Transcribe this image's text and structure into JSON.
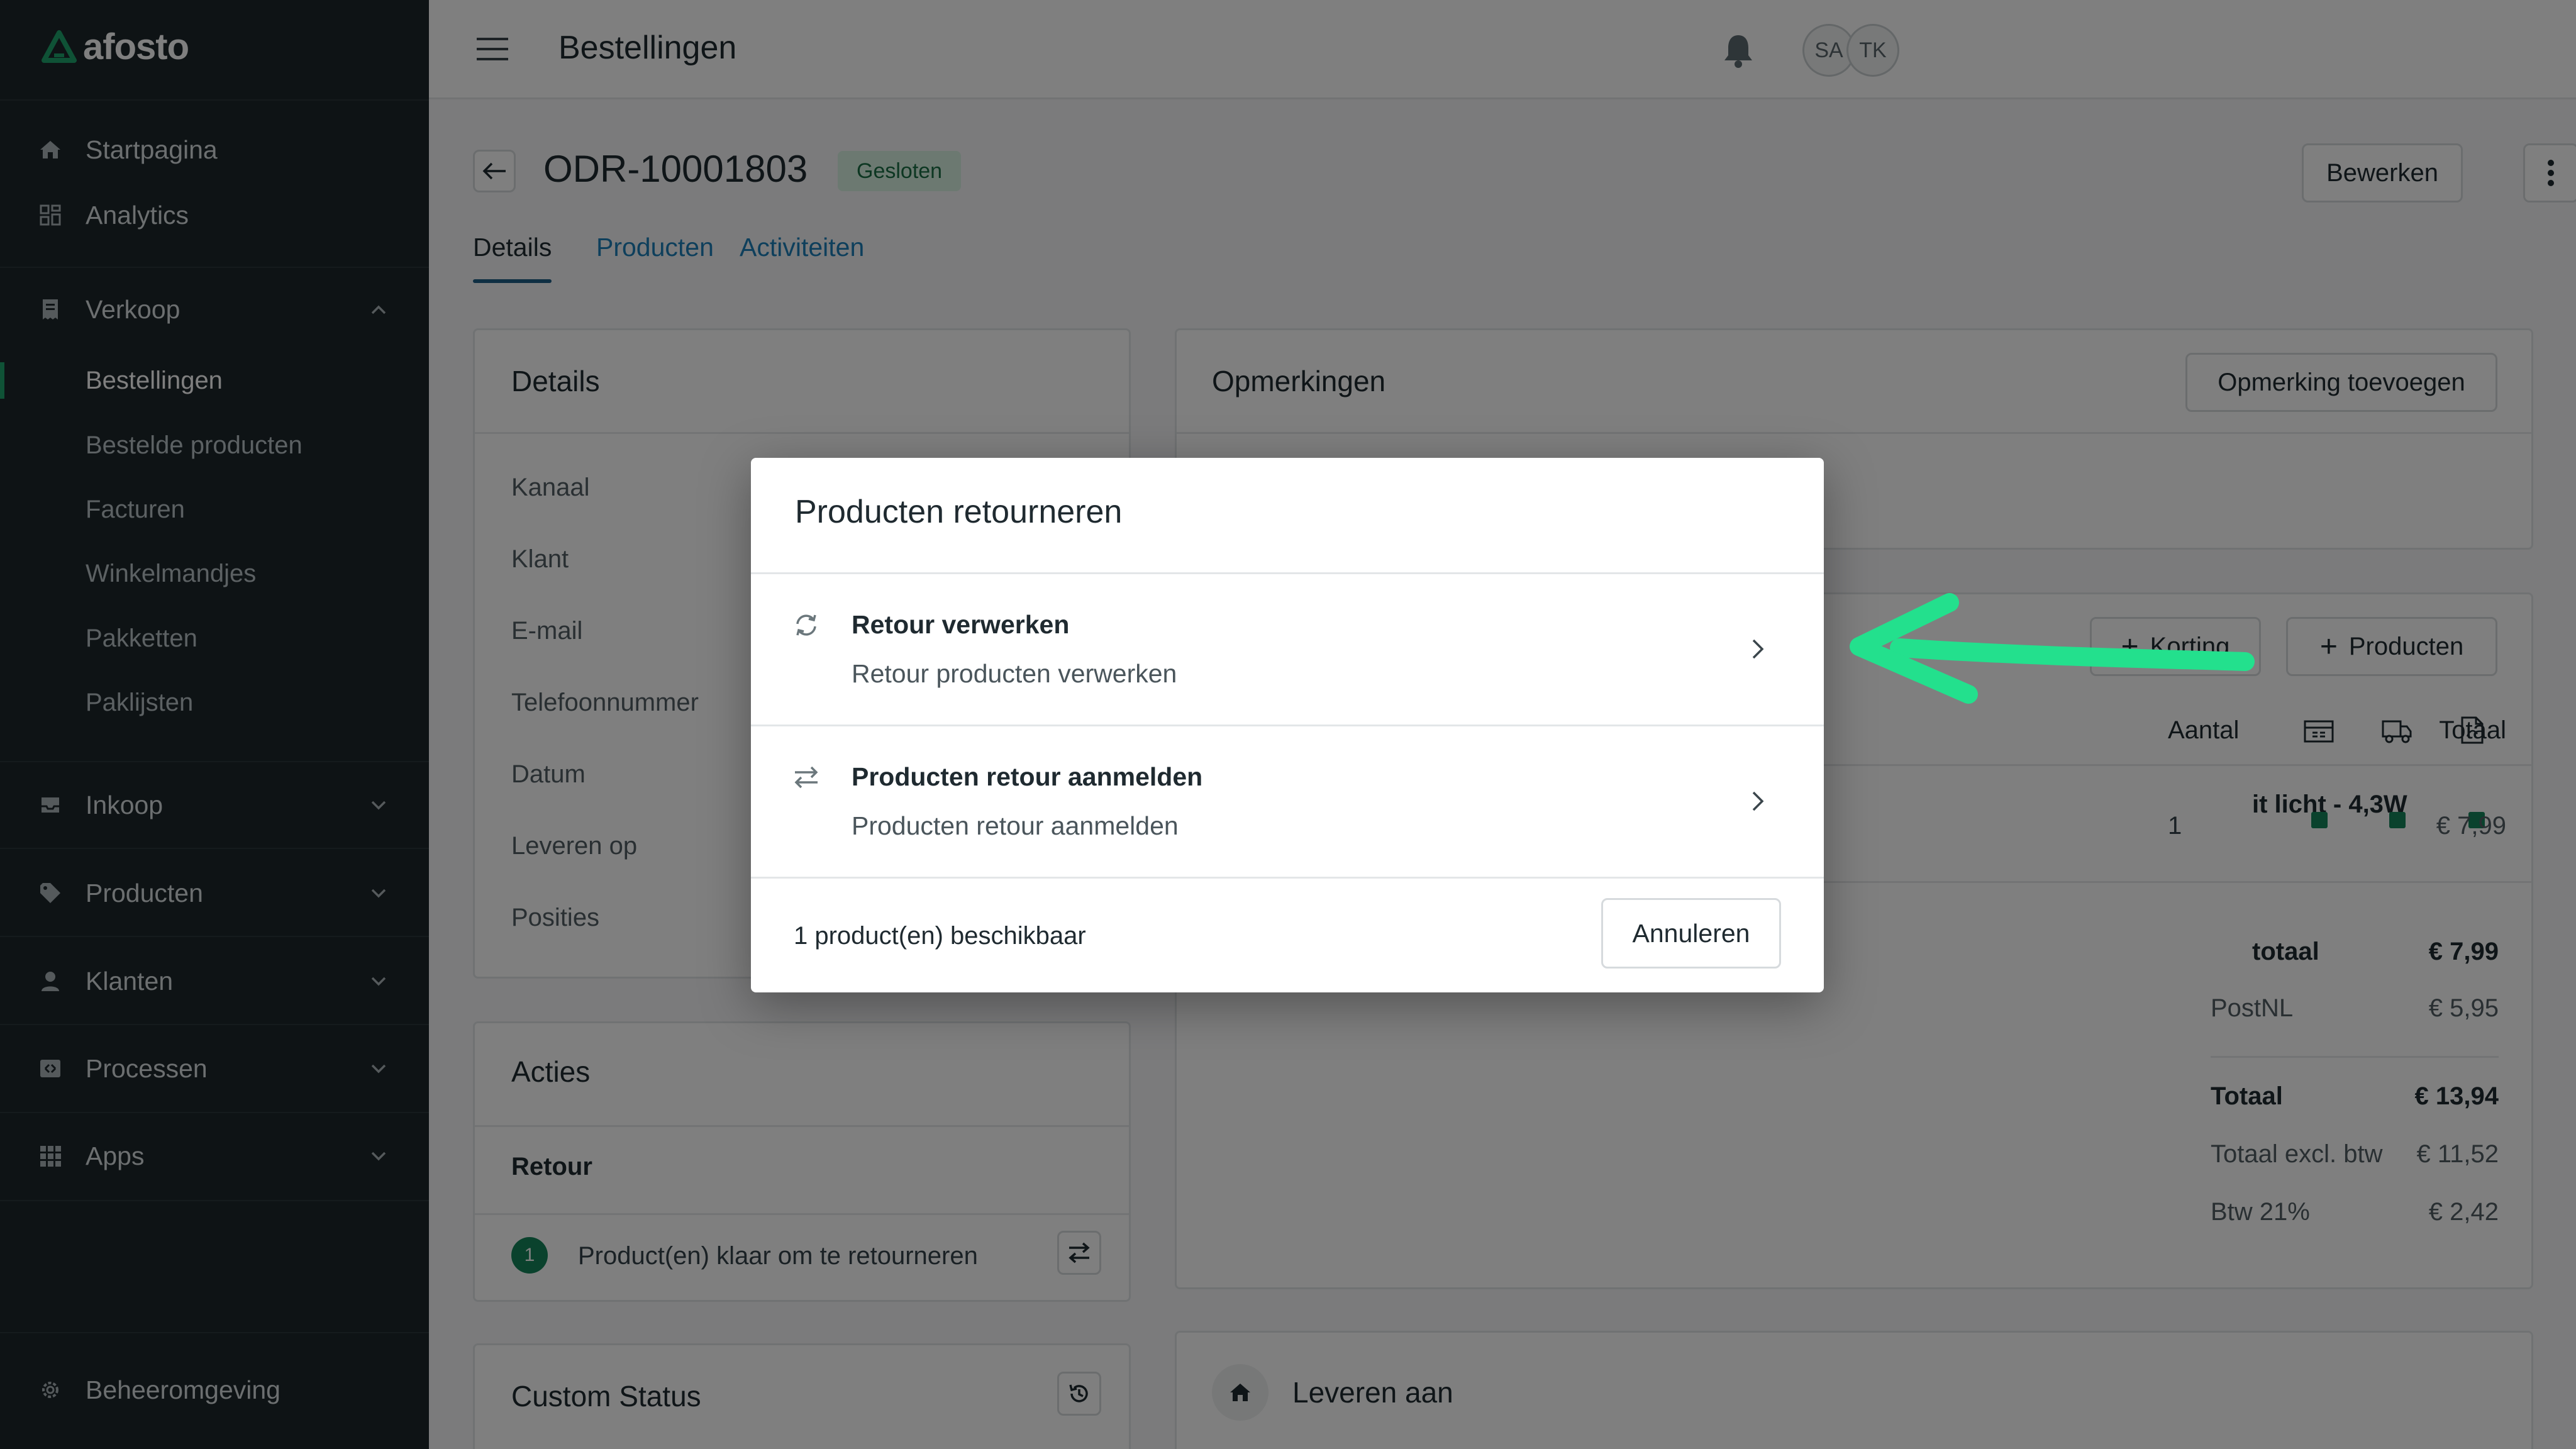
{
  "brand": {
    "name": "afosto",
    "accent": "#1fa56d",
    "sidebar_bg": "#1c262b"
  },
  "sidebar": {
    "top_items": [
      {
        "label": "Startpagina",
        "icon": "home-icon"
      },
      {
        "label": "Analytics",
        "icon": "grid-icon"
      }
    ],
    "sections": [
      {
        "label": "Verkoop",
        "icon": "receipt-icon",
        "expanded": true,
        "children": [
          "Bestellingen",
          "Bestelde producten",
          "Facturen",
          "Winkelmandjes",
          "Pakketten",
          "Paklijsten"
        ],
        "active_child": "Bestellingen"
      },
      {
        "label": "Inkoop",
        "icon": "inbox-icon",
        "expanded": false
      },
      {
        "label": "Producten",
        "icon": "tag-icon",
        "expanded": false
      },
      {
        "label": "Klanten",
        "icon": "user-icon",
        "expanded": false
      },
      {
        "label": "Processen",
        "icon": "process-icon",
        "expanded": false
      },
      {
        "label": "Apps",
        "icon": "apps-icon",
        "expanded": false
      }
    ],
    "footer_item": {
      "label": "Beheeromgeving",
      "icon": "gear-icon"
    }
  },
  "topbar": {
    "title": "Bestellingen",
    "avatars": [
      "SA",
      "TK"
    ]
  },
  "order": {
    "id": "ODR-10001803",
    "status": "Gesloten",
    "edit_label": "Bewerken",
    "tabs": [
      "Details",
      "Producten",
      "Activiteiten"
    ],
    "active_tab": "Details"
  },
  "details_card": {
    "title": "Details",
    "fields": [
      "Kanaal",
      "Klant",
      "E-mail",
      "Telefoonnummer",
      "Datum",
      "Leveren op",
      "Posities"
    ]
  },
  "acties_card": {
    "title": "Acties",
    "section": "Retour",
    "count": "1",
    "text": "Product(en) klaar om te retourneren"
  },
  "custom_status_card": {
    "title": "Custom Status"
  },
  "remarks_card": {
    "title": "Opmerkingen",
    "add_label": "Opmerking toevoegen"
  },
  "products_card": {
    "discount_label": "Korting",
    "add_products_label": "Producten",
    "col_quantity": "Aantal",
    "col_total": "Totaal",
    "row": {
      "name_fragment": "it licht - 4,3W",
      "quantity": "1",
      "total": "€ 7,99"
    },
    "summary": [
      {
        "label": "totaal",
        "value": "€ 7,99",
        "bold": true
      },
      {
        "label": "PostNL",
        "value": "€ 5,95",
        "bold": false
      },
      {
        "label": "Totaal",
        "value": "€ 13,94",
        "bold": true
      },
      {
        "label": "Totaal excl. btw",
        "value": "€ 11,52",
        "bold": false
      },
      {
        "label": "Btw 21%",
        "value": "€ 2,42",
        "bold": false
      }
    ]
  },
  "delivery_card": {
    "title": "Leveren aan"
  },
  "modal": {
    "title": "Producten retourneren",
    "options": [
      {
        "title": "Retour verwerken",
        "description": "Retour producten verwerken",
        "icon": "refresh-icon"
      },
      {
        "title": "Producten retour aanmelden",
        "description": "Producten retour aanmelden",
        "icon": "swap-icon"
      }
    ],
    "footer_text": "1 product(en) beschikbaar",
    "cancel_label": "Annuleren"
  },
  "annotation": {
    "arrow_color": "#23e08d"
  }
}
